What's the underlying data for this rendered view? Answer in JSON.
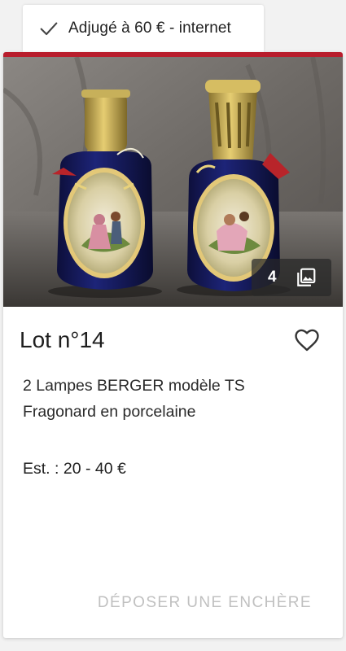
{
  "status": {
    "label": "Adjugé à 60 € - internet",
    "icon": "check-icon"
  },
  "card": {
    "accent_color": "#b81d2c",
    "photo": {
      "count": "4",
      "count_icon": "photo-gallery-icon",
      "alt": "2 Lampes BERGER modèle TS Fragonard en porcelaine"
    },
    "lot_title": "Lot n°14",
    "favorite_icon": "heart-outline-icon",
    "description": "2 Lampes BERGER modèle TS Fragonard en porcelaine",
    "estimate": "Est. : 20 - 40 €",
    "bid_label": "DÉPOSER UNE ENCHÈRE"
  }
}
